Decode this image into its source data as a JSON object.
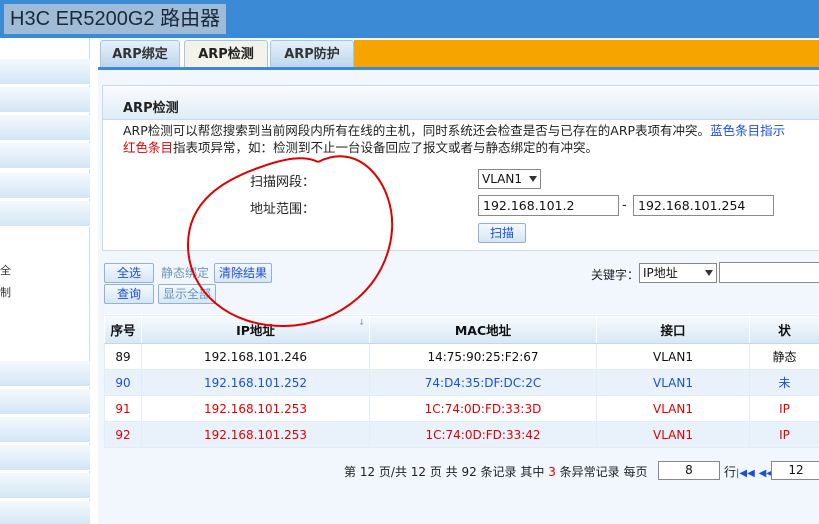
{
  "window_title": "H3C ER5200G2 路由器",
  "sidebar": {
    "fragments": [
      "全",
      "制"
    ]
  },
  "tabs": [
    "ARP绑定",
    "ARP检测",
    "ARP防护"
  ],
  "section_title": "ARP检测",
  "description": {
    "line1": "ARP检测可以帮您搜索到当前网段内所有在线的主机，同时系统还会检查是否与已存在的ARP表项有冲突。",
    "line1_blue": "蓝色条目指示",
    "line2_red": "红色条目",
    "line2": "指表项异常，如：检测到不止一台设备回应了报文或者与静态绑定的有冲突。"
  },
  "form": {
    "segment_label": "扫描网段：",
    "segment_value": "VLAN1",
    "range_label": "地址范围：",
    "range_start": "192.168.101.2",
    "range_sep": "-",
    "range_end": "192.168.101.254",
    "scan_button": "扫描"
  },
  "toolbar": {
    "select_all": "全选",
    "static_bind": "静态绑定",
    "clear_results": "清除结果",
    "query": "查询",
    "show_all": "显示全部",
    "keyword_label": "关键字：",
    "keyword_value": "IP地址",
    "keyword_input": ""
  },
  "table": {
    "columns": [
      "序号",
      "IP地址",
      "MAC地址",
      "接口",
      "状"
    ],
    "rows": [
      {
        "no": "89",
        "ip": "192.168.101.246",
        "mac": "14:75:90:25:F2:67",
        "iface": "VLAN1",
        "status": "静态",
        "color": "normal"
      },
      {
        "no": "90",
        "ip": "192.168.101.252",
        "mac": "74:D4:35:DF:DC:2C",
        "iface": "VLAN1",
        "status": "未",
        "color": "blue"
      },
      {
        "no": "91",
        "ip": "192.168.101.253",
        "mac": "1C:74:0D:FD:33:3D",
        "iface": "VLAN1",
        "status": "IP",
        "color": "red"
      },
      {
        "no": "92",
        "ip": "192.168.101.253",
        "mac": "1C:74:0D:FD:33:42",
        "iface": "VLAN1",
        "status": "IP",
        "color": "red"
      }
    ]
  },
  "pager": {
    "text_before": "第 12 页/共 12 页 共 92 条记录 其中",
    "abnormal_count": "3",
    "text_after": "条异常记录 每页",
    "per_page": "8",
    "goto_label": "行",
    "page_input": "12"
  },
  "colors": {
    "titlebar": "#3a8ad6",
    "tab_accent": "#f5a400",
    "blue_text": "#1a4fd6",
    "red_text": "#e10000",
    "annotation": "#e00000"
  }
}
